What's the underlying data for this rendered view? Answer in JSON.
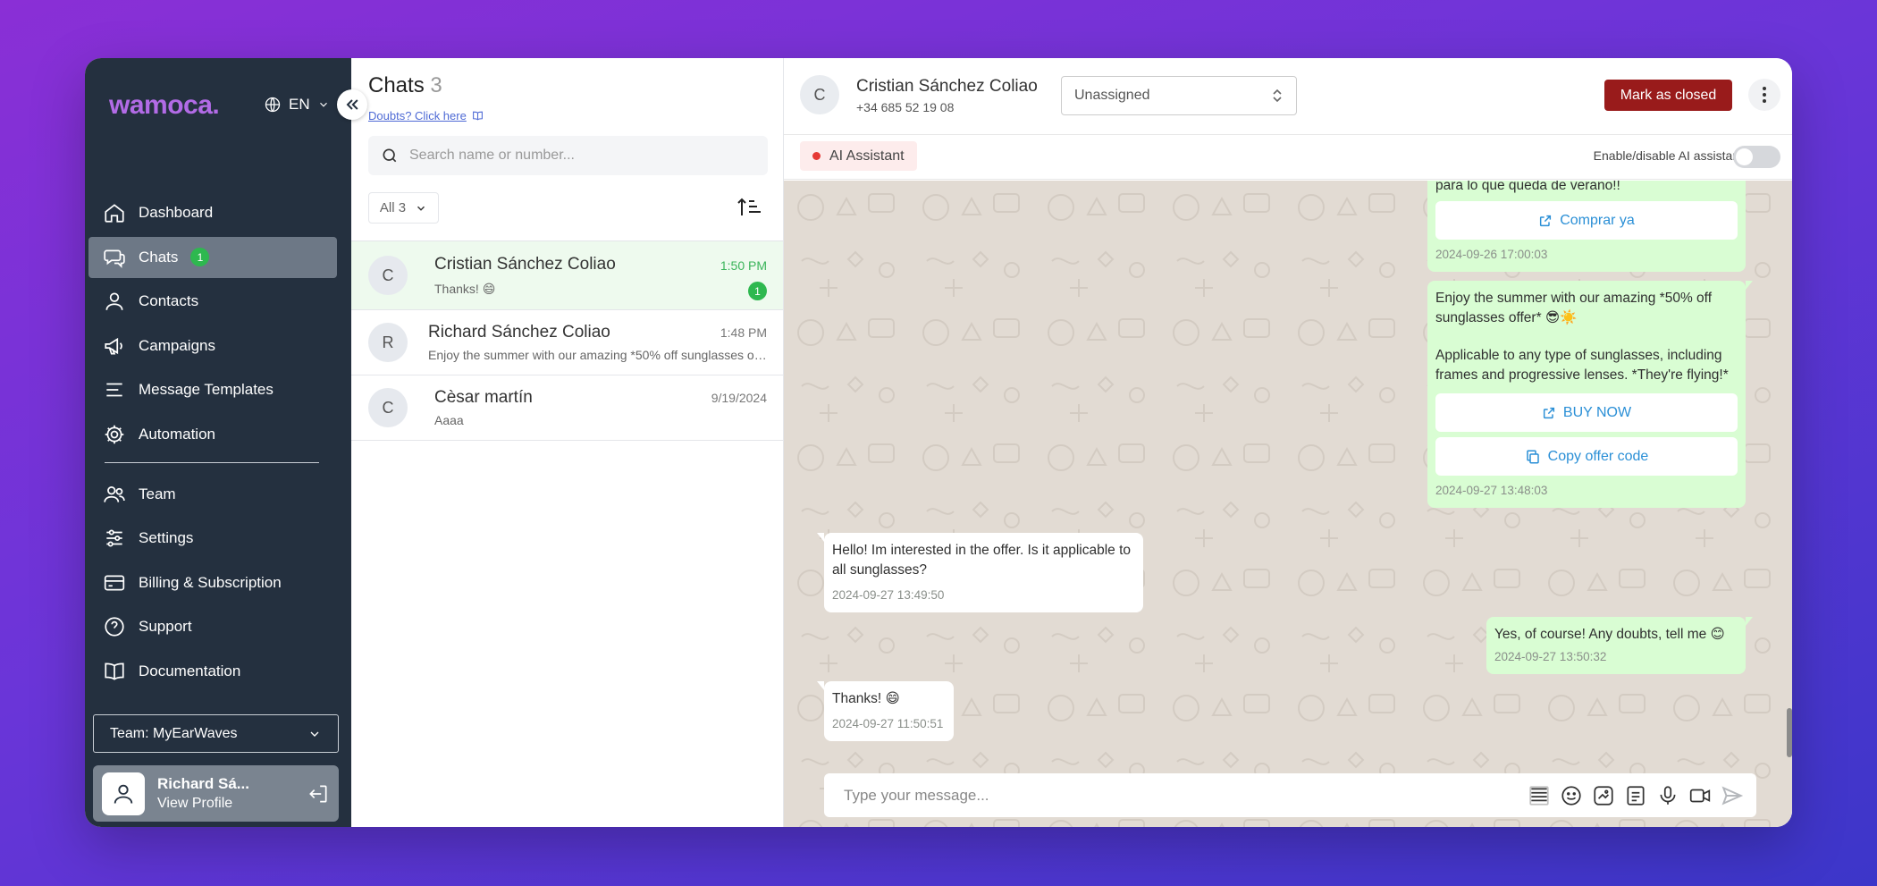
{
  "brand": {
    "logo_text": "wamoca.",
    "logo_color": "#b26be6"
  },
  "language": {
    "code": "EN"
  },
  "sidebar": {
    "items": [
      {
        "label": "Dashboard",
        "icon": "home-icon"
      },
      {
        "label": "Chats",
        "icon": "chat-icon",
        "badge": "1",
        "active": true
      },
      {
        "label": "Contacts",
        "icon": "user-icon"
      },
      {
        "label": "Campaigns",
        "icon": "megaphone-icon"
      },
      {
        "label": "Message Templates",
        "icon": "lines-icon"
      },
      {
        "label": "Automation",
        "icon": "gear-icon"
      },
      {
        "label": "Team",
        "icon": "users-icon"
      },
      {
        "label": "Settings",
        "icon": "sliders-icon"
      },
      {
        "label": "Billing & Subscription",
        "icon": "card-icon"
      },
      {
        "label": "Support",
        "icon": "help-icon"
      },
      {
        "label": "Documentation",
        "icon": "book-icon"
      }
    ],
    "team_select": "Team: MyEarWaves",
    "profile": {
      "name": "Richard Sá...",
      "link": "View Profile"
    }
  },
  "chatlist": {
    "title": "Chats",
    "count": "3",
    "doubts_link": "Doubts? Click here",
    "search_placeholder": "Search name or number...",
    "filter_label": "All 3",
    "chats": [
      {
        "initial": "C",
        "name": "Cristian Sánchez Coliao",
        "time": "1:50 PM",
        "preview": "Thanks! 😄",
        "unread": "1"
      },
      {
        "initial": "R",
        "name": "Richard Sánchez Coliao",
        "time": "1:48 PM",
        "preview": "Enjoy the summer with our amazing *50% off sunglasses of..."
      },
      {
        "initial": "C",
        "name": "Cèsar martín",
        "time": "9/19/2024",
        "preview": "Aaaa"
      }
    ]
  },
  "conversation": {
    "contact_initial": "C",
    "contact_name": "Cristian Sánchez Coliao",
    "contact_phone": "+34 685 52 19 08",
    "assignee": "Unassigned",
    "close_button": "Mark as closed",
    "ai_tag": "AI Assistant",
    "ai_toggle_label": "Enable/disable AI assistant",
    "messages": {
      "m1_text": "para lo que queda de verano!!",
      "m1_button": "Comprar ya",
      "m1_time": "2024-09-26 17:00:03",
      "m2_line1": "Enjoy the summer with our amazing *50% off sunglasses offer* 😎☀️",
      "m2_line2": "Applicable to any type of sunglasses, including frames and progressive lenses. *They're flying!*",
      "m2_button1": "BUY NOW",
      "m2_button2": "Copy offer code",
      "m2_time": "2024-09-27 13:48:03",
      "m3_text": "Hello! Im interested in the offer. Is it applicable to all sunglasses?",
      "m3_time": "2024-09-27 13:49:50",
      "m4_text": "Yes, of course! Any doubts, tell me 😊",
      "m4_time": "2024-09-27 13:50:32",
      "m5_text": "Thanks! 😄",
      "m5_time": "2024-09-27 11:50:51"
    },
    "composer_placeholder": "Type your message..."
  },
  "colors": {
    "sidebar_bg": "#24303f",
    "active_nav": "#6d7886",
    "badge_green": "#2eb84f",
    "close_button": "#991b1b",
    "outgoing_bubble": "#d9fdd3",
    "chat_bg": "#e2dbd3",
    "link_blue": "#2a8fd6"
  }
}
